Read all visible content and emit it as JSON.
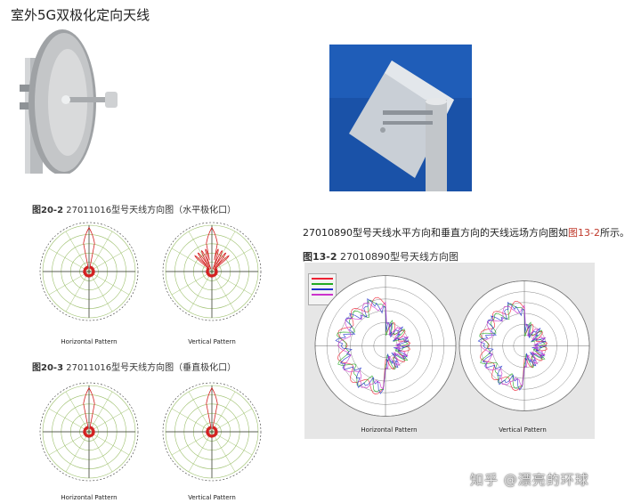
{
  "title": "室外5G双极化定向天线",
  "fig20_2": {
    "label": "图20-2",
    "text": "27011016型号天线方向图（水平极化口）",
    "left_caption": "Horizontal Pattern",
    "right_caption": "Vertical Pattern"
  },
  "fig20_3": {
    "label": "图20-3",
    "text": "27011016型号天线方向图（垂直极化口）",
    "left_caption": "Horizontal Pattern",
    "right_caption": "Vertical Pattern"
  },
  "paragraph": {
    "before": "27010890型号天线水平方向和垂直方向的天线远场方向图如",
    "link": "图13-2",
    "after": "所示。"
  },
  "fig13_2": {
    "label": "图13-2",
    "text": "27010890型号天线方向图",
    "left_caption": "Horizontal Pattern",
    "right_caption": "Vertical Pattern"
  },
  "watermark": "知乎 @漂亮的环球",
  "colors": {
    "pattern_red": "#d42020",
    "grid_green": "#9bbf6a",
    "panel_gray": "#e6e6e6",
    "photo_blue": "#1a52a8",
    "link_red": "#c0392b"
  }
}
